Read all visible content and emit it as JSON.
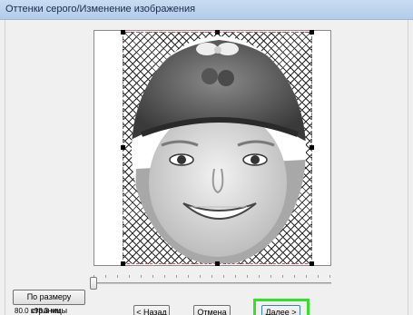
{
  "window": {
    "title": "Оттенки серого/Изменение изображения"
  },
  "preview": {
    "image_description_icon": "portrait-photo"
  },
  "slider": {
    "value_percent": 0
  },
  "buttons": {
    "fit_page": "По размеру страницы",
    "back": "< Назад",
    "cancel": "Отмена",
    "next": "Далее >"
  },
  "status": {
    "size": "80.0 x98.3 мм"
  },
  "colors": {
    "highlight": "#35e02a",
    "crop_border": "#d04a5a"
  }
}
